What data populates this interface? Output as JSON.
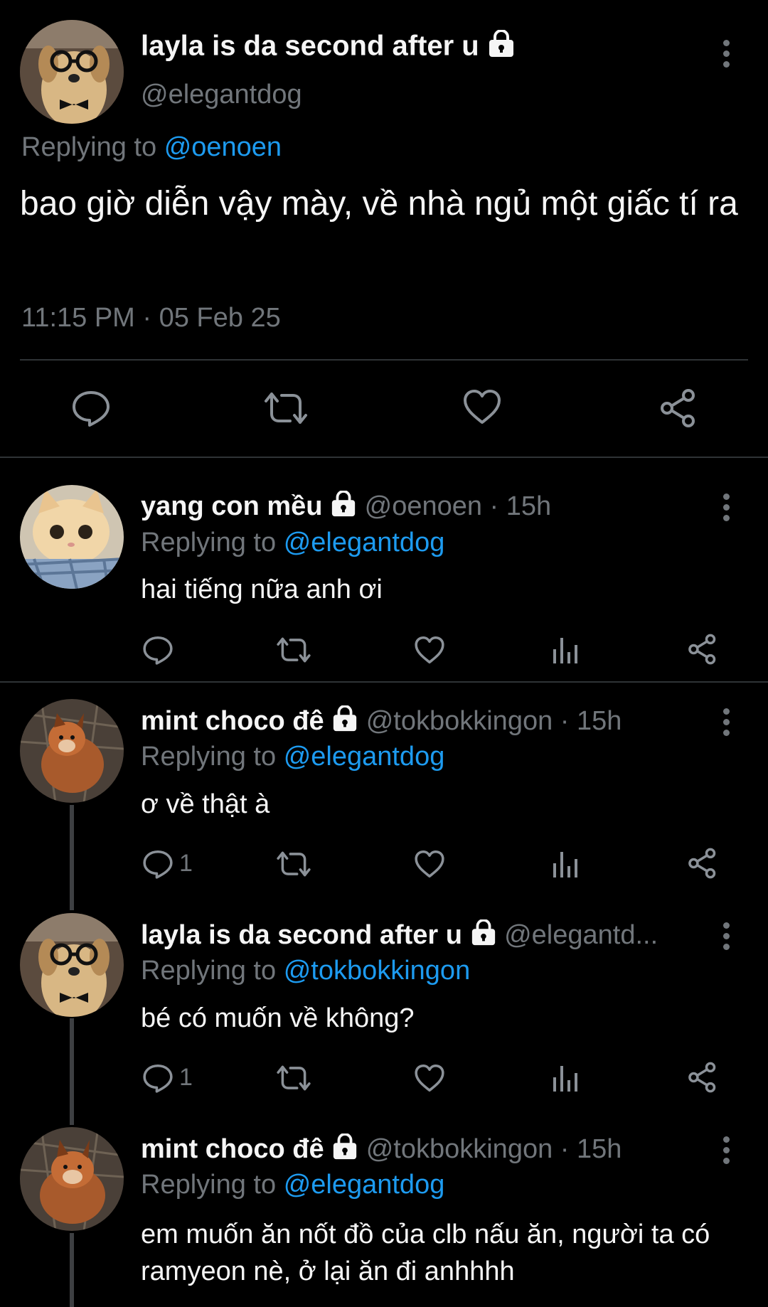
{
  "main_tweet": {
    "display_name": "layla is da second after u",
    "handle": "@elegantdog",
    "replying_label": "Replying to",
    "replying_to": "@oenoen",
    "text": "bao giờ diễn vậy mày, về nhà ngủ một giấc tí ra",
    "timestamp": "11:15 PM · 05 Feb 25"
  },
  "replies": [
    {
      "display_name": "yang con mều",
      "handle_time": "@oenoen · 15h",
      "replying_label": "Replying to",
      "replying_to": "@elegantdog",
      "text": "hai tiếng nữa anh ơi",
      "reply_count": ""
    },
    {
      "display_name": "mint choco đê",
      "handle_time": "@tokbokkingon · 15h",
      "replying_label": "Replying to",
      "replying_to": "@elegantdog",
      "text": "ơ về thật à",
      "reply_count": "1"
    },
    {
      "display_name": "layla is da second after u",
      "handle_time": "@elegantd...",
      "replying_label": "Replying to",
      "replying_to": "@tokbokkingon",
      "text": "bé có muốn về không?",
      "reply_count": "1"
    },
    {
      "display_name": "mint choco đê",
      "handle_time": "@tokbokkingon · 15h",
      "replying_label": "Replying to",
      "replying_to": "@elegantdog",
      "text": "em muốn ăn nốt đồ của clb nấu ăn, người ta có ramyeon nè, ở lại ăn đi anhhhh",
      "reply_count": ""
    }
  ],
  "colors": {
    "background": "#000000",
    "link": "#1d9bf0",
    "muted": "#71767b",
    "divider": "#2f3336"
  }
}
